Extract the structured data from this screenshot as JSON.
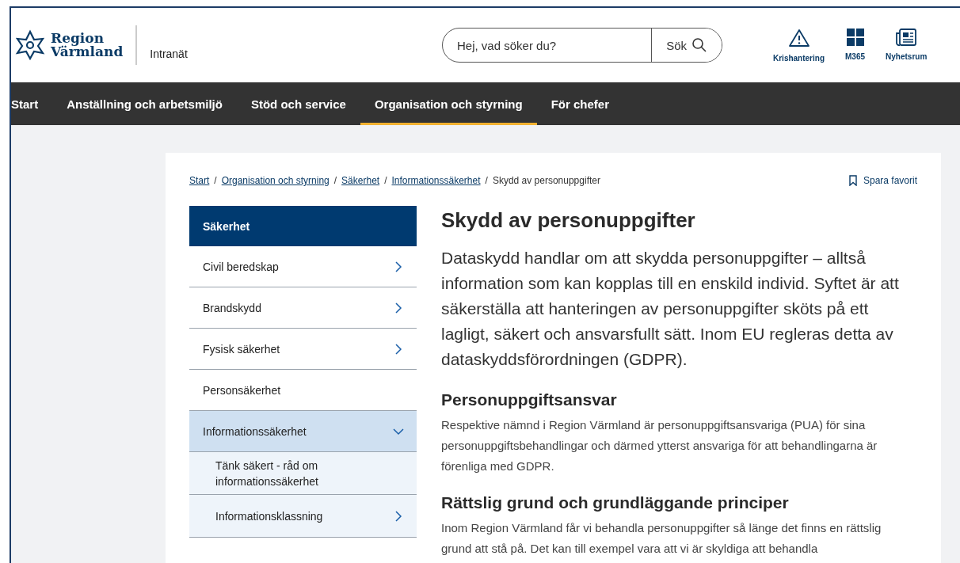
{
  "logo": {
    "line1": "Region",
    "line2": "Värmland",
    "site": "Intranät"
  },
  "search": {
    "placeholder": "Hej, vad söker du?",
    "button": "Sök"
  },
  "quick_links": [
    {
      "label": "Krishantering",
      "kind": "warning"
    },
    {
      "label": "M365",
      "kind": "grid"
    },
    {
      "label": "Nyhetsrum",
      "kind": "news"
    }
  ],
  "nav": [
    {
      "label": "Start",
      "selected": false
    },
    {
      "label": "Anställning och arbetsmiljö",
      "selected": false
    },
    {
      "label": "Stöd och service",
      "selected": false
    },
    {
      "label": "Organisation och styrning",
      "selected": true
    },
    {
      "label": "För chefer",
      "selected": false
    }
  ],
  "breadcrumb": [
    "Start",
    "Organisation och styrning",
    "Säkerhet",
    "Informationssäkerhet"
  ],
  "breadcrumb_separator": "/",
  "breadcrumb_current": "Skydd av personuppgifter",
  "save_favorite": "Spara favorit",
  "sidebar": {
    "title": "Säkerhet",
    "items": [
      {
        "label": "Civil beredskap",
        "kind": "group",
        "expanded": false
      },
      {
        "label": "Brandskydd",
        "kind": "group",
        "expanded": false
      },
      {
        "label": "Fysisk säkerhet",
        "kind": "group",
        "expanded": false
      },
      {
        "label": "Personsäkerhet",
        "kind": "page"
      },
      {
        "label": "Informationssäkerhet",
        "kind": "group",
        "expanded": true,
        "children": [
          {
            "label": "Tänk säkert - råd om informationssäkerhet",
            "kind": "page"
          },
          {
            "label": "Informationsklassning",
            "kind": "group",
            "expanded": false
          }
        ]
      }
    ]
  },
  "article": {
    "title": "Skydd av personuppgifter",
    "lead": "Dataskydd handlar om att skydda personuppgifter – alltså information som kan kopplas till en enskild individ. Syftet är att säkerställa att hanteringen av personuppgifter sköts på ett lagligt, säkert och ansvarsfullt sätt. Inom EU regleras detta av dataskyddsförordningen (GDPR).",
    "sections": [
      {
        "heading": "Personuppgiftsansvar",
        "text": "Respektive nämnd i Region Värmland är personuppgiftsansvariga (PUA) för sina personuppgiftsbehandlingar och därmed ytterst ansvariga för att behandlingarna är förenliga med GDPR."
      },
      {
        "heading": "Rättslig grund och grundläggande principer",
        "text": "Inom Region Värmland får vi behandla personuppgifter så länge det finns en rättslig grund att stå på. Det kan till exempel vara att vi är skyldiga att behandla"
      }
    ]
  }
}
